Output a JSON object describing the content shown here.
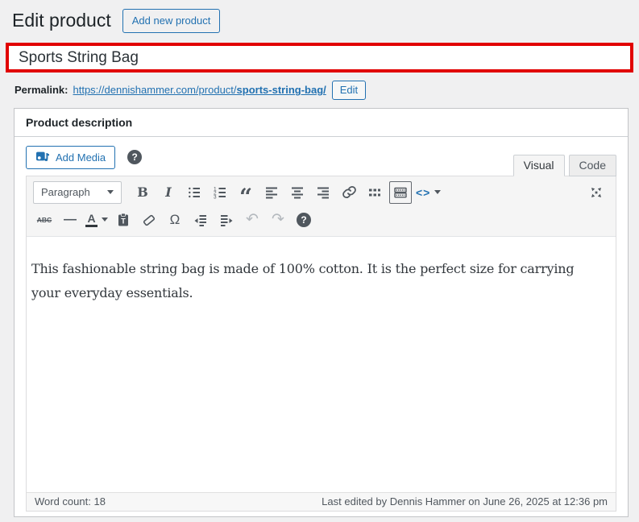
{
  "page": {
    "heading": "Edit product",
    "add_new_button": "Add new product"
  },
  "product_title": {
    "value": "Sports String Bag"
  },
  "permalink": {
    "label": "Permalink:",
    "url_base": "https://dennishammer.com/product/",
    "url_slug": "sports-string-bag/",
    "edit_button": "Edit"
  },
  "panel": {
    "title": "Product description"
  },
  "editor": {
    "add_media_button": "Add Media",
    "tabs": [
      {
        "label": "Visual"
      },
      {
        "label": "Code"
      }
    ],
    "paragraph_select": "Paragraph",
    "content": "This fashionable string bag is made of 100% cotton. It is the perfect size for carrying your everyday essentials.",
    "status": {
      "word_count_label": "Word count:",
      "word_count": "18",
      "last_edited": "Last edited by Dennis Hammer on June 26, 2025 at 12:36 pm"
    }
  },
  "icons": {
    "bold": "B",
    "italic": "I",
    "blockquote": "“",
    "strikethrough": "ABC",
    "horizontal_rule": "—",
    "text_color": "A",
    "special_char": "Ω",
    "undo": "↶",
    "redo": "↷",
    "help": "?",
    "shortcode": "<>"
  },
  "colors": {
    "accent": "#2271b1",
    "highlight": "#e10000",
    "toolbar_icon": "#50575e"
  }
}
